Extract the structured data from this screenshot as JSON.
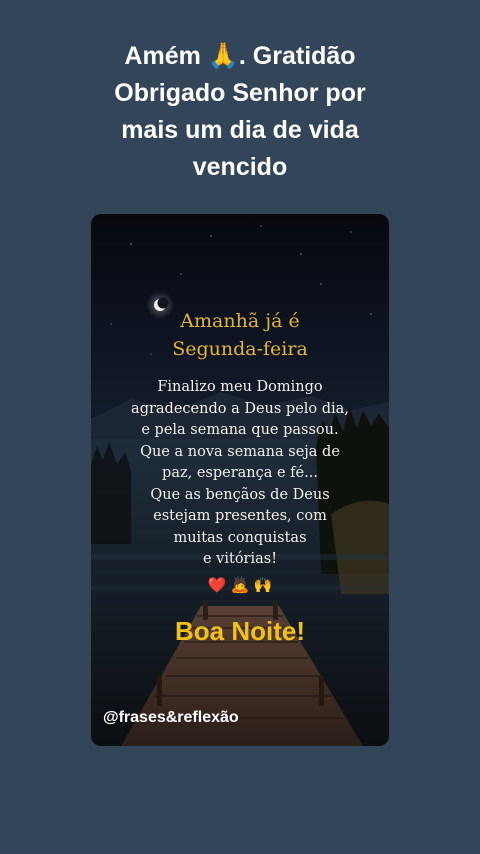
{
  "post": {
    "caption_lines": [
      "Amém 🙏. Gratidão",
      "Obrigado Senhor por",
      "mais um dia de vida",
      "vencido"
    ]
  },
  "card": {
    "heading_line1": "Amanhã já é",
    "heading_line2": "Segunda-feira",
    "message_lines": [
      "Finalizo meu Domingo",
      "agradecendo a Deus pelo dia,",
      "e pela semana que passou.",
      "Que a nova semana seja de",
      "paz, esperança e fé...",
      "Que as bençãos de Deus",
      "estejam presentes, com",
      "muitas conquistas",
      "e vitórias!"
    ],
    "emoji_heart": "❤️",
    "emoji_pray_person": "🙇",
    "emoji_raised_hands": "🙌",
    "good_night": "Boa Noite!",
    "watermark": "@frases&reflexão"
  },
  "colors": {
    "background": "#334659",
    "heading": "#e2b43a",
    "good_night": "#f2c119",
    "message_text": "#f3f0ea"
  },
  "icons": [
    "praying-hands-icon",
    "heart-icon",
    "bowing-person-icon",
    "raised-hands-icon",
    "moon-icon"
  ]
}
